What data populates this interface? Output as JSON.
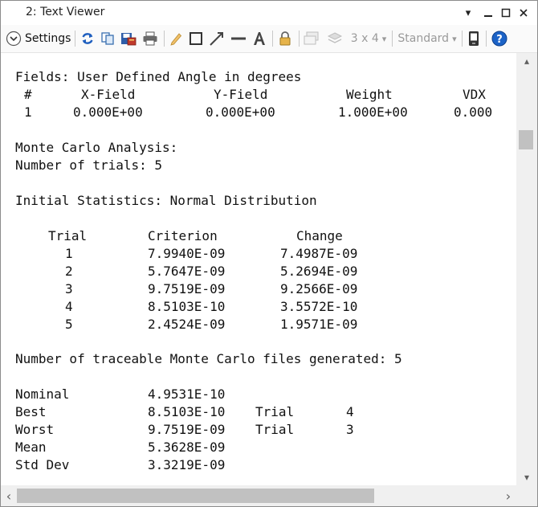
{
  "window": {
    "title": "2: Text Viewer",
    "controls": {
      "pin": "▾",
      "minimize": "—",
      "maximize": "☐",
      "close": "✕"
    }
  },
  "toolbar": {
    "settings_label": "Settings",
    "layout_label": "3 x 4",
    "layout_arrow": "▾",
    "style_label": "Standard",
    "style_arrow": "▾"
  },
  "content": {
    "fields_header": "Fields: User Defined Angle in degrees",
    "fields_columns": [
      "#",
      "X-Field",
      "Y-Field",
      "Weight",
      "VDX"
    ],
    "fields_row": [
      "1",
      "0.000E+00",
      "0.000E+00",
      "1.000E+00",
      "0.000"
    ],
    "mc_title": "Monte Carlo Analysis:",
    "mc_trials": "Number of trials: 5",
    "init_stats": "Initial Statistics: Normal Distribution",
    "trial_columns": [
      "Trial",
      "Criterion",
      "Change"
    ],
    "trials": [
      [
        "1",
        "7.9940E-09",
        "7.4987E-09"
      ],
      [
        "2",
        "5.7647E-09",
        "5.2694E-09"
      ],
      [
        "3",
        "9.7519E-09",
        "9.2566E-09"
      ],
      [
        "4",
        "8.5103E-10",
        "3.5572E-10"
      ],
      [
        "5",
        "2.4524E-09",
        "1.9571E-09"
      ]
    ],
    "traceable": "Number of traceable Monte Carlo files generated: 5",
    "summary": [
      {
        "label": "Nominal",
        "value": "4.9531E-10",
        "trial_label": "",
        "trial": ""
      },
      {
        "label": "Best",
        "value": "8.5103E-10",
        "trial_label": "Trial",
        "trial": "4"
      },
      {
        "label": "Worst",
        "value": "9.7519E-09",
        "trial_label": "Trial",
        "trial": "3"
      },
      {
        "label": "Mean",
        "value": "5.3628E-09",
        "trial_label": "",
        "trial": ""
      },
      {
        "label": "Std Dev",
        "value": "3.3219E-09",
        "trial_label": "",
        "trial": ""
      }
    ]
  },
  "scrollbars": {
    "up": "▴",
    "down": "▾",
    "left": "‹",
    "right": "›",
    "vertical_position": 0.2,
    "horizontal_position": 0.0
  },
  "colors": {
    "accent_blue": "#1f5fbf",
    "help_blue": "#1c63c7",
    "settings_blue": "#2f6db5"
  }
}
